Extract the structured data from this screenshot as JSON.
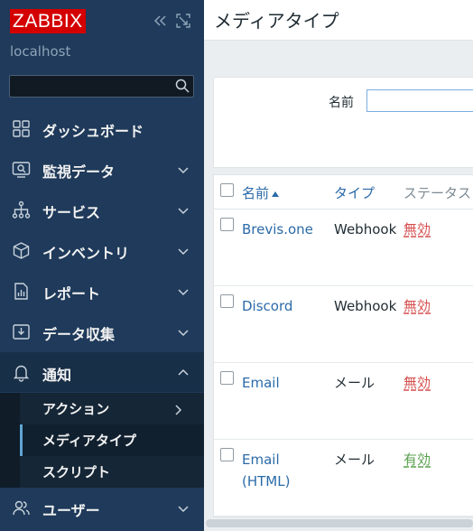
{
  "sidebar": {
    "logo": "ZABBIX",
    "server": "localhost",
    "search": {
      "value": "",
      "placeholder": ""
    },
    "menu": [
      {
        "label": "ダッシュボード",
        "icon": "dashboard-icon"
      },
      {
        "label": "監視データ",
        "icon": "monitoring-icon"
      },
      {
        "label": "サービス",
        "icon": "services-icon"
      },
      {
        "label": "インベントリ",
        "icon": "inventory-icon"
      },
      {
        "label": "レポート",
        "icon": "reports-icon"
      },
      {
        "label": "データ収集",
        "icon": "data-collection-icon"
      },
      {
        "label": "通知",
        "icon": "bell-icon"
      },
      {
        "label": "ユーザー",
        "icon": "users-icon"
      }
    ],
    "submenu": [
      {
        "label": "アクション"
      },
      {
        "label": "メディアタイプ"
      },
      {
        "label": "スクリプト"
      }
    ]
  },
  "header": {
    "title": "メディアタイプ"
  },
  "filter": {
    "name_label": "名前",
    "name_value": ""
  },
  "table": {
    "columns": {
      "name": "名前",
      "type": "タイプ",
      "status": "ステータス"
    },
    "rows": [
      {
        "name": "Brevis.one",
        "type": "Webhook",
        "status": "無効",
        "enabled": false
      },
      {
        "name": "Discord",
        "type": "Webhook",
        "status": "無効",
        "enabled": false
      },
      {
        "name": "Email",
        "type": "メール",
        "status": "無効",
        "enabled": false
      },
      {
        "name": "Email (HTML)",
        "type": "メール",
        "status": "有効",
        "enabled": true
      }
    ]
  },
  "colors": {
    "sidebar_bg": "#1f3a5a",
    "logo_red": "#d40000",
    "link_blue": "#2b6aa8",
    "status_disabled": "#d64e4e",
    "status_enabled": "#59a14f"
  }
}
